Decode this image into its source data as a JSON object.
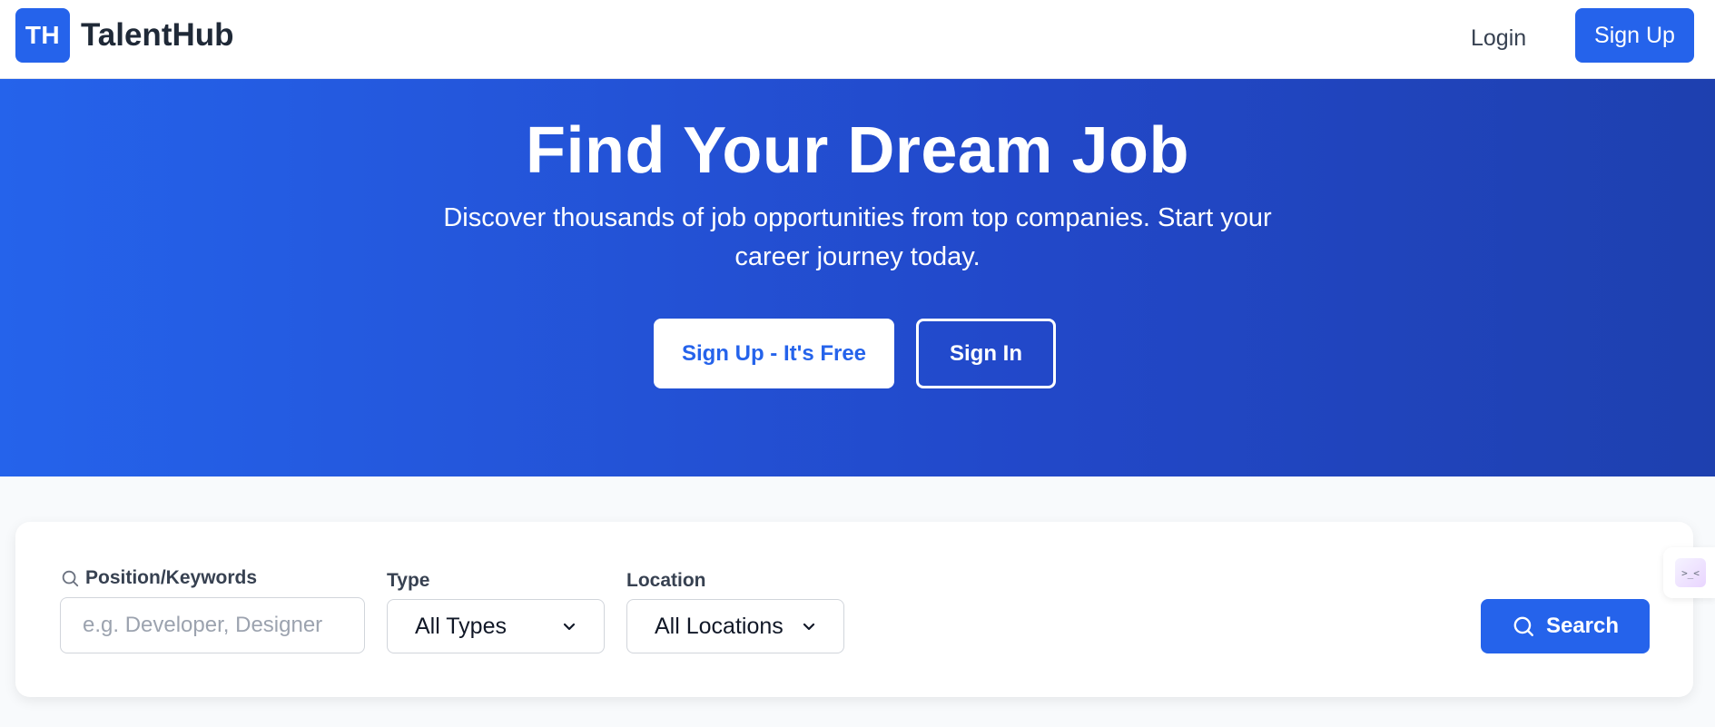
{
  "brand": {
    "logo_text": "TH",
    "name": "TalentHub"
  },
  "nav": {
    "login_label": "Login",
    "signup_label": "Sign Up"
  },
  "hero": {
    "title": "Find Your Dream Job",
    "subtitle": "Discover thousands of job opportunities from top companies. Start your career journey today.",
    "primary_cta": "Sign Up - It's Free",
    "secondary_cta": "Sign In"
  },
  "search": {
    "keywords_label": "Position/Keywords",
    "keywords_placeholder": "e.g. Developer, Designer",
    "keywords_value": "",
    "type_label": "Type",
    "type_selected": "All Types",
    "location_label": "Location",
    "location_selected": "All Locations",
    "button_label": "Search"
  },
  "side_widget": {
    "glyph": ">_<"
  },
  "colors": {
    "primary": "#2563eb",
    "hero_gradient_end": "#1e40af",
    "page_background": "#f8fafc"
  },
  "icons": {
    "label_icon": "search-icon",
    "button_icon": "search-icon",
    "select_icon": "chevron-down-icon"
  }
}
